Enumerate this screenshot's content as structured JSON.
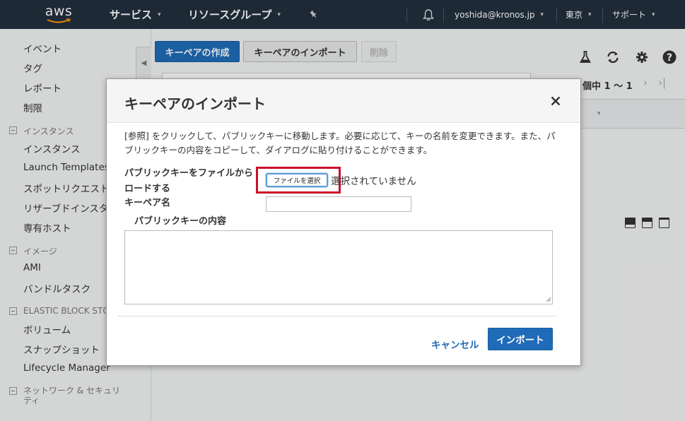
{
  "topnav": {
    "logo_text": "aws",
    "services": "サービス",
    "resource_groups": "リソースグループ",
    "user": "yoshida@kronos.jp",
    "region": "東京",
    "support": "サポート",
    "caret": "▾"
  },
  "sidebar": {
    "items_top": [
      "イベント",
      "タグ",
      "レポート",
      "制限"
    ],
    "section_instances": "インスタンス",
    "instances_items": [
      "インスタンス",
      "Launch Templates",
      "スポットリクエスト",
      "リザーブドインスタンス",
      "専有ホスト"
    ],
    "section_images": "イメージ",
    "images_items": [
      "AMI",
      "バンドルタスク"
    ],
    "section_ebs": "ELASTIC BLOCK STORE",
    "ebs_items": [
      "ボリューム",
      "スナップショット",
      "Lifecycle Manager"
    ],
    "section_network": "ネットワーク & セキュリティ"
  },
  "toolbar": {
    "create_keypair": "キーペアの作成",
    "import_keypair": "キーペアのインポート",
    "delete": "削除"
  },
  "paging": {
    "text": "個中 1 〜 1",
    "next": "›",
    "last": "›|"
  },
  "modal": {
    "title": "キーペアのインポート",
    "close": "×",
    "description": "[参照] をクリックして、パブリックキーに移動します。必要に応じて、キーの名前を変更できます。また、パブリックキーの内容をコピーして、ダイアログに貼り付けることができます。",
    "file_label_line1": "パブリックキーをファイルから",
    "file_label_line2": "ロードする",
    "file_button": "ファイルを選択",
    "file_status": "選択されていません",
    "keypair_name_label": "キーペア名",
    "keypair_name_value": "",
    "public_key_label": "パブリックキーの内容",
    "public_key_value": "",
    "cancel": "キャンセル",
    "import": "インポート"
  },
  "colors": {
    "nav_bg": "#232f3e",
    "primary": "#1f6bb8",
    "highlight_box": "#c8102e"
  }
}
